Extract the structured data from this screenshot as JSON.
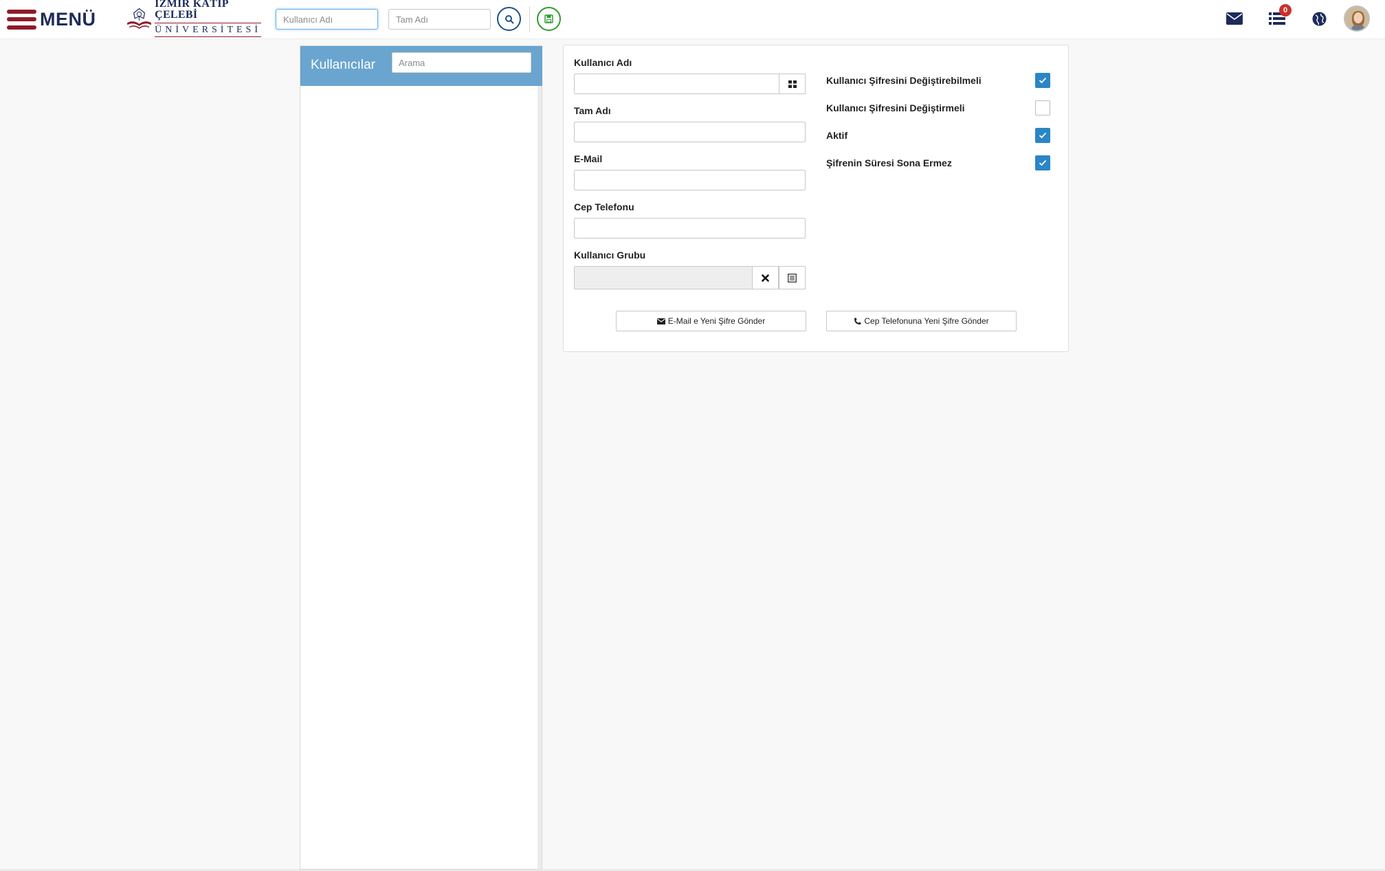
{
  "topbar": {
    "menu_label": "MENÜ",
    "logo_line1": "İZMİR KÂTİP ÇELEBİ",
    "logo_line2": "ÜNİVERSİTESİ",
    "search_username_placeholder": "Kullanıcı Adı",
    "search_fullname_placeholder": "Tam Adı",
    "search_button_icon": "search-icon",
    "save_button_icon": "floppy-save-icon",
    "mail_icon": "envelope-icon",
    "tasks_icon": "list-icon",
    "tasks_badge": "0",
    "language_icon": "globe-icon",
    "avatar_icon": "user-avatar"
  },
  "users_panel": {
    "title": "Kullanıcılar",
    "search_placeholder": "Arama",
    "items": []
  },
  "form": {
    "username_label": "Kullanıcı Adı",
    "username_value": "",
    "username_addon_icon": "grid-icon",
    "fullname_label": "Tam Adı",
    "fullname_value": "",
    "email_label": "E-Mail",
    "email_value": "",
    "phone_label": "Cep Telefonu",
    "phone_value": "",
    "group_label": "Kullanıcı Grubu",
    "group_value": "",
    "group_clear_icon": "close-icon",
    "group_select_icon": "list-select-icon",
    "checkboxes": [
      {
        "label": "Kullanıcı Şifresini Değiştirebilmeli",
        "checked": true
      },
      {
        "label": "Kullanıcı Şifresini Değiştirmeli",
        "checked": false
      },
      {
        "label": "Aktif",
        "checked": true
      },
      {
        "label": "Şifrenin Süresi Sona Ermez",
        "checked": true
      }
    ],
    "send_email_button": "E-Mail e Yeni Şifre Gönder",
    "send_phone_button": "Cep Telefonuna Yeni Şifre Gönder"
  },
  "colors": {
    "brand_red": "#8e1b2b",
    "brand_navy": "#1d2b5a",
    "panel_header": "#6aa5cf",
    "checkbox_on": "#2b86c5",
    "badge": "#c9302c"
  }
}
